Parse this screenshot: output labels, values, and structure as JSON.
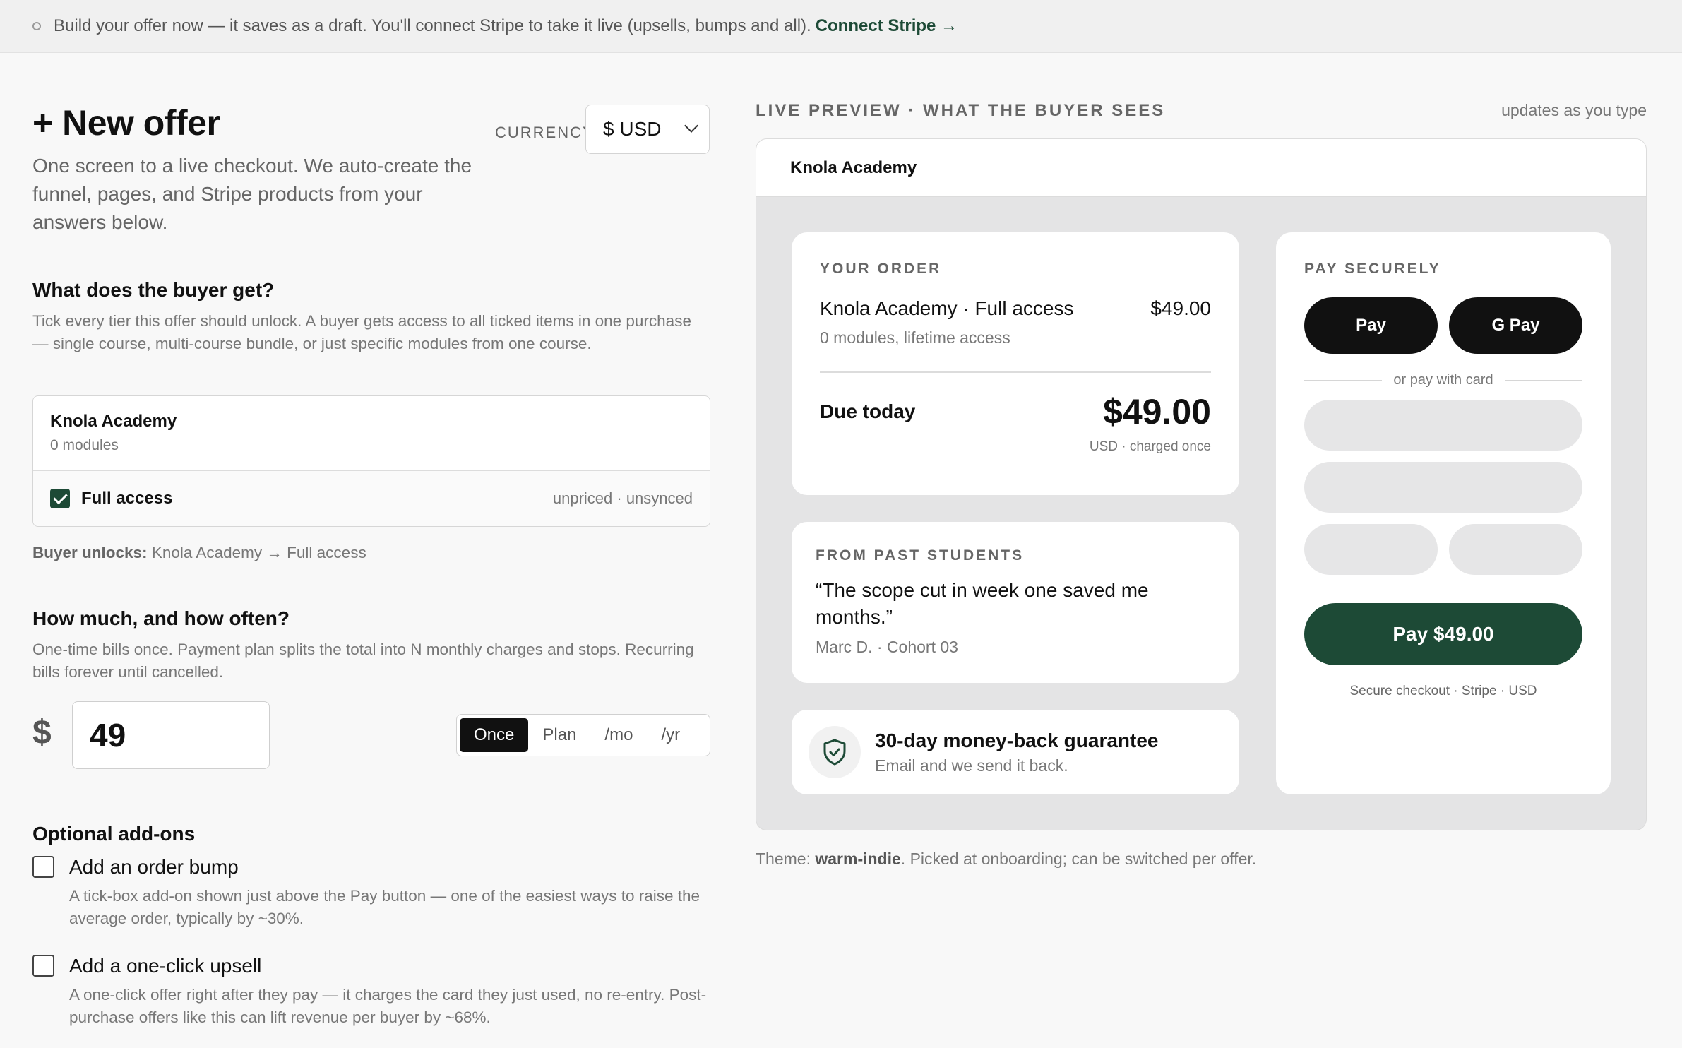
{
  "banner": {
    "text": "Build your offer now — it saves as a draft. You'll connect Stripe to take it live (upsells, bumps and all).",
    "link": "Connect Stripe →"
  },
  "form": {
    "title": "+ New offer",
    "currency_label": "CURRENCY",
    "currency_value": "$ USD",
    "subtitle": "One screen to a live checkout. We auto-create the funnel, pages, and Stripe products from your answers below.",
    "section1": {
      "heading": "What does the buyer get?",
      "description": "Tick every tier this offer should unlock. A buyer gets access to all ticked items in one purchase — single course, multi-course bundle, or just specific modules from one course."
    },
    "tier": {
      "name": "Knola Academy",
      "sub": "0 modules",
      "item_label": "Full access",
      "item_checked": true,
      "item_status": "unpriced · unsynced"
    },
    "unlocks": {
      "label": "Buyer unlocks:",
      "value": "Knola Academy → Full access"
    },
    "section2": {
      "heading": "How much, and how often?",
      "description": "One-time bills once. Payment plan splits the total into N monthly charges and stops. Recurring bills forever until cancelled."
    },
    "price": {
      "symbol": "$",
      "value": "49"
    },
    "frequency": {
      "options": [
        "Once",
        "Plan",
        "/mo",
        "/yr"
      ],
      "selected": "Once"
    },
    "addons": {
      "heading": "Optional add-ons",
      "bump_title": "Add an order bump",
      "bump_desc": "A tick-box add-on shown just above the Pay button — one of the easiest ways to raise the average order, typically by ~30%.",
      "upsell_title": "Add a one-click upsell",
      "upsell_desc": "A one-click offer right after they pay — it charges the card they just used, no re-entry. Post-purchase offers like this can lift revenue per buyer by ~68%."
    }
  },
  "preview": {
    "label": "LIVE PREVIEW · WHAT THE BUYER SEES",
    "updates": "updates as you type",
    "brand": "Knola Academy",
    "order": {
      "caps": "YOUR ORDER",
      "item": "Knola Academy · Full access",
      "item_price": "$49.00",
      "item_sub": "0 modules, lifetime access",
      "due_label": "Due today",
      "due_amount": "$49.00",
      "due_note": "USD · charged once"
    },
    "testimonial": {
      "caps": "FROM PAST STUDENTS",
      "quote": "“The scope cut in week one saved me months.”",
      "by": "Marc D. · Cohort 03"
    },
    "guarantee": {
      "title": "30-day money-back guarantee",
      "sub": "Email and we send it back."
    },
    "pay": {
      "caps": "PAY SECURELY",
      "wallet1": "Pay",
      "wallet2": "G Pay",
      "or": "or pay with card",
      "button": "Pay $49.00",
      "note": "Secure checkout · Stripe · USD"
    },
    "theme": {
      "prefix": "Theme:",
      "name": "warm-indie",
      "suffix": ". Picked at onboarding; can be switched per offer."
    }
  },
  "colors": {
    "accent": "#1d4a36",
    "dark": "#111111",
    "muted": "#777777"
  }
}
